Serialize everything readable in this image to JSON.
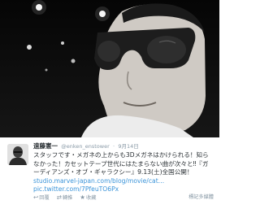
{
  "tweet": {
    "display_name": "遠藤憲一",
    "handle": "@enken_enstower",
    "separator": "·",
    "date": "9月14日",
    "text": "スタッフです・メガネの上からも3Dメガネはかけられる！知らなかった！カセットテープ世代にはたまらない曲が次々と‼『ガーディアンズ・オブ・ギャラクシー』9.13(土)全国公開！",
    "link_1": "studio.marvel-japan.com/blog/movie/cat…",
    "link_2": "pic.twitter.com/7PfeuTO6Px"
  },
  "actions": {
    "reply": {
      "icon": "reply-icon",
      "label": "回覆"
    },
    "retweet": {
      "icon": "retweet-icon",
      "label": "轉推"
    },
    "favorite": {
      "icon": "star-icon",
      "label": "收藏"
    },
    "flag": "標記多媒體"
  },
  "colors": {
    "link": "#3b94d9",
    "muted": "#8899a6",
    "text": "#292f33"
  }
}
